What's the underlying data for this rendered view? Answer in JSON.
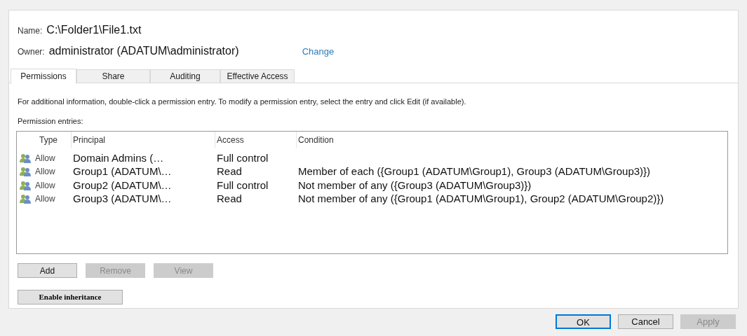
{
  "file": {
    "name_label": "Name:",
    "name": "C:\\Folder1\\File1.txt",
    "owner_label": "Owner:",
    "owner": "administrator (ADATUM\\administrator)",
    "change_link": "Change"
  },
  "tabs": [
    {
      "label": "Permissions",
      "selected": true
    },
    {
      "label": "Share",
      "selected": false
    },
    {
      "label": "Auditing",
      "selected": false
    },
    {
      "label": "Effective Access",
      "selected": false
    }
  ],
  "info_text": "For additional information, double-click a permission entry. To modify a permission entry, select the entry and click Edit (if available).",
  "entries_label": "Permission entries:",
  "table": {
    "columns": [
      "Type",
      "Principal",
      "Access",
      "Condition"
    ],
    "rows": [
      {
        "type": "Allow",
        "principal": "Domain Admins (…",
        "access": "Full control",
        "condition": ""
      },
      {
        "type": "Allow",
        "principal": "Group1 (ADATUM\\…",
        "access": "Read",
        "condition": "Member of each ({Group1 (ADATUM\\Group1), Group3 (ADATUM\\Group3)})"
      },
      {
        "type": "Allow",
        "principal": "Group2 (ADATUM\\…",
        "access": "Full control",
        "condition": "Not member of any ({Group3 (ADATUM\\Group3)})"
      },
      {
        "type": "Allow",
        "principal": "Group3 (ADATUM\\…",
        "access": "Read",
        "condition": "Not member of any ({Group1 (ADATUM\\Group1), Group2 (ADATUM\\Group2)})"
      }
    ]
  },
  "entry_buttons": [
    {
      "label": "Add",
      "disabled": false
    },
    {
      "label": "Remove",
      "disabled": true
    },
    {
      "label": "View",
      "disabled": true
    }
  ],
  "inheritance_button": "Enable inheritance",
  "dialog_buttons": [
    {
      "label": "OK",
      "default": true,
      "disabled": false
    },
    {
      "label": "Cancel",
      "default": false,
      "disabled": false
    },
    {
      "label": "Apply",
      "default": false,
      "disabled": true
    }
  ]
}
